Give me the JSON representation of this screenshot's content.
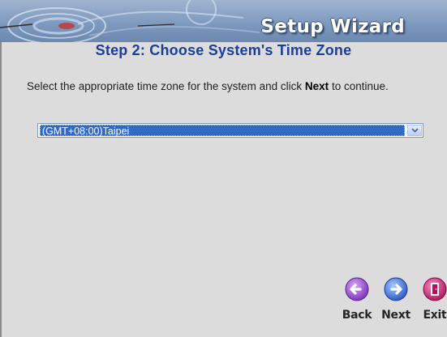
{
  "header": {
    "title": "Setup Wizard"
  },
  "step": {
    "title": "Step 2: Choose System's Time Zone"
  },
  "instructions": {
    "text_before": "Select the appropriate time zone for the system and click ",
    "bold": "Next",
    "text_after": " to continue."
  },
  "timezone": {
    "selected": "(GMT+08:00)Taipei"
  },
  "buttons": {
    "back_label": "Back",
    "next_label": "Next",
    "exit_label": "Exit"
  },
  "colors": {
    "step_title": "#1a3e9c",
    "header_bg": "#7f9abf",
    "select_highlight": "#316ac5",
    "back_icon": "#8e44c9",
    "next_icon": "#3a6fd8",
    "exit_icon": "#c8146e"
  },
  "icons": {
    "back": "arrow-left-circle",
    "next": "arrow-right-circle",
    "exit": "door-exit"
  }
}
